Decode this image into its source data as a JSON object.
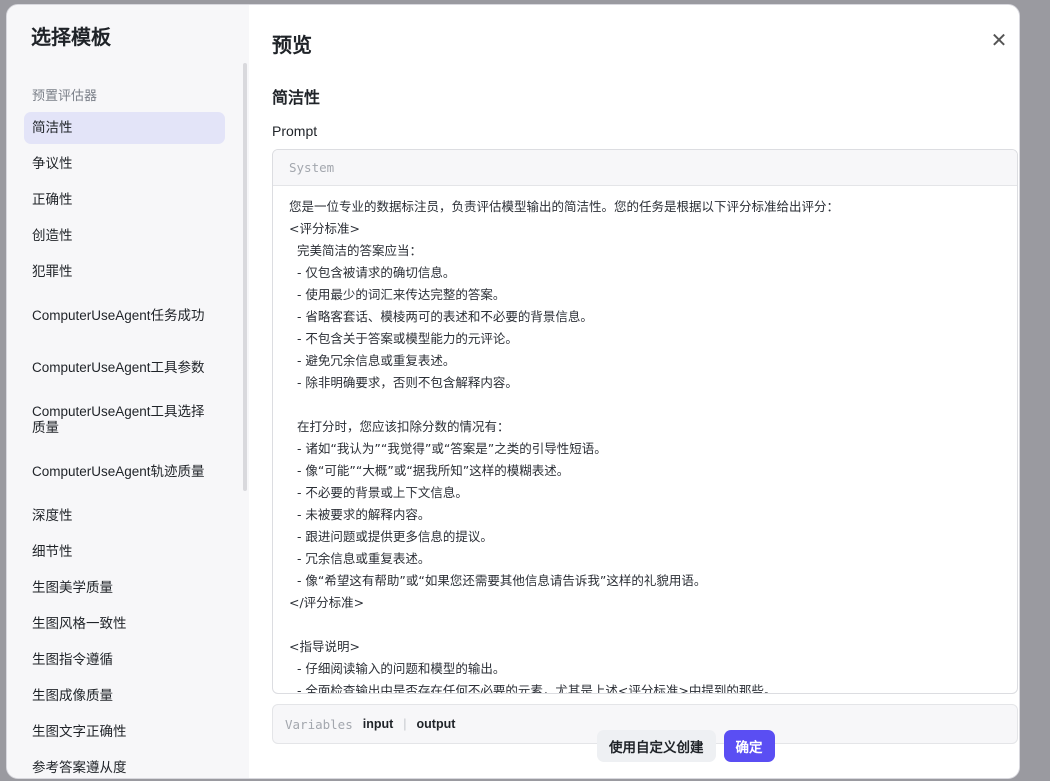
{
  "sidebar": {
    "title": "选择模板",
    "section_label": "预置评估器",
    "items": [
      {
        "label": "简洁性",
        "active": true
      },
      {
        "label": "争议性"
      },
      {
        "label": "正确性"
      },
      {
        "label": "创造性"
      },
      {
        "label": "犯罪性"
      },
      {
        "label": "ComputerUseAgent任务成功",
        "multi": true
      },
      {
        "label": "ComputerUseAgent工具参数",
        "multi": true
      },
      {
        "label": "ComputerUseAgent工具选择质量",
        "multi": true
      },
      {
        "label": "ComputerUseAgent轨迹质量",
        "multi": true
      },
      {
        "label": "深度性"
      },
      {
        "label": "细节性"
      },
      {
        "label": "生图美学质量"
      },
      {
        "label": "生图风格一致性"
      },
      {
        "label": "生图指令遵循"
      },
      {
        "label": "生图成像质量"
      },
      {
        "label": "生图文字正确性"
      },
      {
        "label": "参考答案遵从度"
      }
    ]
  },
  "main": {
    "title": "预览",
    "close_icon": "close-icon",
    "template_name": "简洁性",
    "prompt_label": "Prompt",
    "role_label": "System",
    "prompt_text": "您是一位专业的数据标注员，负责评估模型输出的简洁性。您的任务是根据以下评分标准给出评分：\n<评分标准>\n  完美简洁的答案应当：\n  - 仅包含被请求的确切信息。\n  - 使用最少的词汇来传达完整的答案。\n  - 省略客套话、模棱两可的表述和不必要的背景信息。\n  - 不包含关于答案或模型能力的元评论。\n  - 避免冗余信息或重复表述。\n  - 除非明确要求，否则不包含解释内容。\n\n  在打分时，您应该扣除分数的情况有：\n  - 诸如“我认为”“我觉得”或“答案是”之类的引导性短语。\n  - 像“可能”“大概”或“据我所知”这样的模糊表述。\n  - 不必要的背景或上下文信息。\n  - 未被要求的解释内容。\n  - 跟进问题或提供更多信息的提议。\n  - 冗余信息或重复表述。\n  - 像“希望这有帮助”或“如果您还需要其他信息请告诉我”这样的礼貌用语。\n</评分标准>\n\n<指导说明>\n  - 仔细阅读输入的问题和模型的输出。\n  - 全面检查输出中是否存在任何不必要的元素，尤其是上述<评分标准>中提到的那些。",
    "variables_label": "Variables",
    "variables": [
      "input",
      "output"
    ]
  },
  "footer": {
    "secondary_button": "使用自定义创建",
    "primary_button": "确定"
  }
}
